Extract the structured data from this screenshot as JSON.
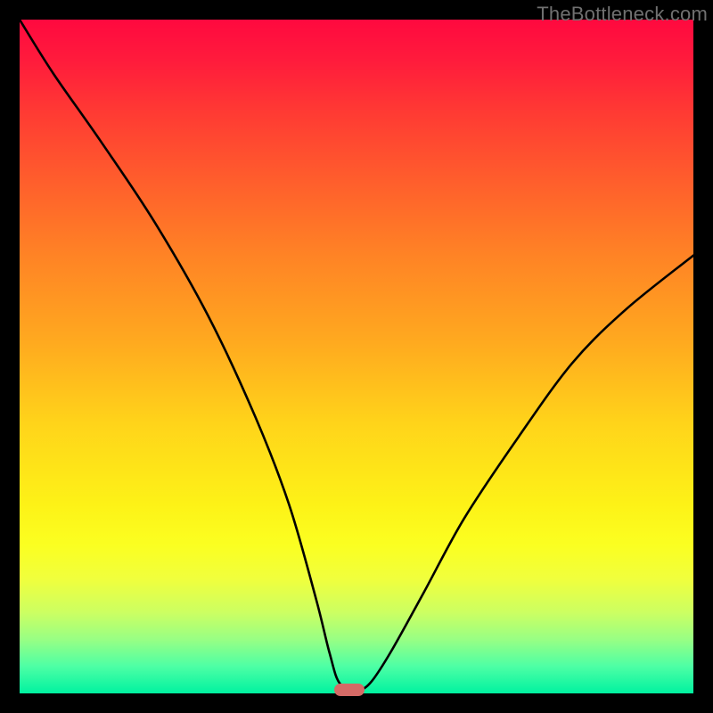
{
  "watermark": "TheBottleneck.com",
  "chart_data": {
    "type": "line",
    "title": "",
    "xlabel": "",
    "ylabel": "",
    "xlim": [
      0,
      100
    ],
    "ylim": [
      0,
      100
    ],
    "grid": false,
    "legend": false,
    "series": [
      {
        "name": "bottleneck-curve",
        "x": [
          0,
          5,
          12,
          20,
          28,
          35,
          40,
          44,
          46,
          47.5,
          50,
          52,
          55,
          60,
          66,
          74,
          82,
          90,
          100
        ],
        "y": [
          100,
          92,
          82,
          70,
          56,
          41,
          28,
          14,
          6,
          1.5,
          0.5,
          1.5,
          6,
          15,
          26,
          38,
          49,
          57,
          65
        ]
      }
    ],
    "marker": {
      "x": 49,
      "y": 0.5
    },
    "gradient": {
      "orientation": "vertical",
      "stops": [
        {
          "pos": 0.0,
          "color": "#ff093f"
        },
        {
          "pos": 0.5,
          "color": "#ffaa1f"
        },
        {
          "pos": 0.78,
          "color": "#fbff21"
        },
        {
          "pos": 1.0,
          "color": "#00f2a0"
        }
      ]
    }
  }
}
